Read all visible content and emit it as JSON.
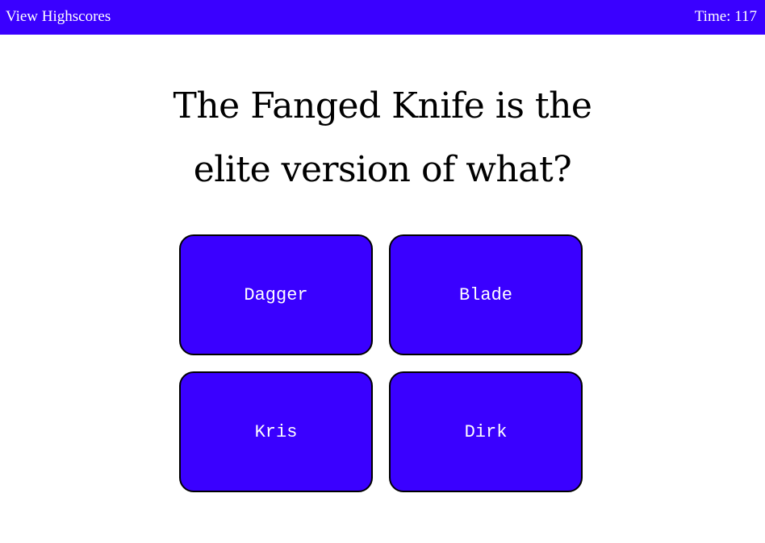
{
  "header": {
    "highscores_label": "View Highscores",
    "timer_label": "Time:",
    "timer_value": "117"
  },
  "question": {
    "line1": "The Fanged Knife is the",
    "line2": "elite version of what?"
  },
  "answers": [
    {
      "label": "Dagger"
    },
    {
      "label": "Blade"
    },
    {
      "label": "Kris"
    },
    {
      "label": "Dirk"
    }
  ],
  "colors": {
    "accent": "#3a00ff",
    "background": "#ffffff",
    "text": "#000000",
    "button_text": "#ffffff"
  }
}
